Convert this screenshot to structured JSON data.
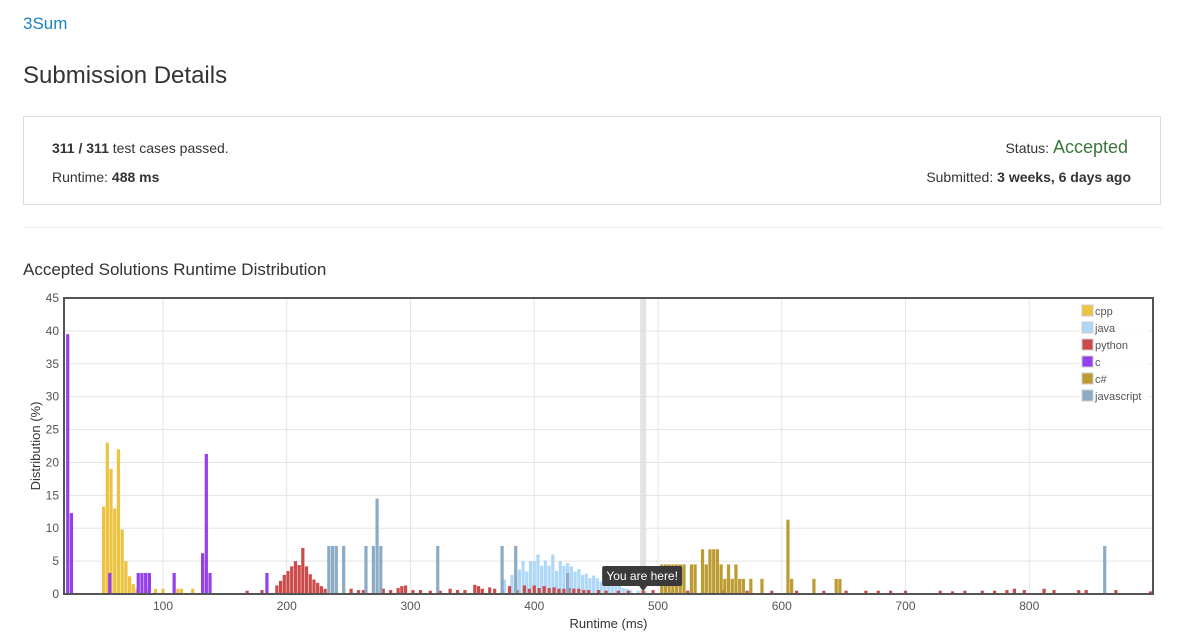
{
  "problem": {
    "title": "3Sum"
  },
  "page": {
    "title": "Submission Details"
  },
  "details": {
    "passed": "311",
    "separator": " / ",
    "total": "311",
    "passed_suffix": " test cases passed.",
    "runtime_label": "Runtime: ",
    "runtime_value": "488 ms",
    "status_label": "Status: ",
    "status_value": "Accepted",
    "submitted_label": "Submitted: ",
    "submitted_value": "3 weeks, 6 days ago"
  },
  "distribution": {
    "title": "Accepted Solutions Runtime Distribution"
  },
  "colors": {
    "accent_link": "#1a82c3",
    "status_accepted": "#3c763d",
    "cpp": "#edc240",
    "java": "#afd8f8",
    "python": "#cb4b4b",
    "c": "#9440ed",
    "csharp": "#bd9b33",
    "javascript": "#8cacc6"
  },
  "chart_data": {
    "type": "bar",
    "xlabel": "Runtime (ms)",
    "ylabel": "Distribution (%)",
    "xlim": [
      20,
      900
    ],
    "ylim": [
      0,
      45
    ],
    "x_ticks": [
      100,
      200,
      300,
      400,
      500,
      600,
      700,
      800
    ],
    "y_ticks": [
      0,
      5,
      10,
      15,
      20,
      25,
      30,
      35,
      40,
      45
    ],
    "grid": true,
    "legend_position": "top-right",
    "bar_width": 2.6,
    "highlight": {
      "x": 488,
      "label": "You are here!"
    },
    "series": [
      {
        "name": "cpp",
        "color": "#edc240",
        "points": [
          [
            52,
            13.3
          ],
          [
            55,
            23
          ],
          [
            58,
            19
          ],
          [
            61,
            13
          ],
          [
            64,
            22
          ],
          [
            67,
            9.8
          ],
          [
            70,
            5
          ],
          [
            73,
            2.7
          ],
          [
            76,
            1.5
          ],
          [
            79,
            0.8
          ],
          [
            88,
            0.8
          ],
          [
            94,
            0.8
          ],
          [
            100,
            0.8
          ],
          [
            112,
            0.8
          ],
          [
            115,
            0.8
          ],
          [
            124,
            0.8
          ]
        ]
      },
      {
        "name": "java",
        "color": "#afd8f8",
        "points": [
          [
            376,
            2.2
          ],
          [
            382,
            2.9
          ],
          [
            385,
            2.4
          ],
          [
            388,
            3.7
          ],
          [
            391,
            5
          ],
          [
            394,
            3.4
          ],
          [
            397,
            5
          ],
          [
            400,
            5
          ],
          [
            403,
            6
          ],
          [
            406,
            4.3
          ],
          [
            409,
            5.1
          ],
          [
            412,
            4.3
          ],
          [
            415,
            6
          ],
          [
            418,
            3.5
          ],
          [
            421,
            5
          ],
          [
            424,
            4.3
          ],
          [
            427,
            4.7
          ],
          [
            430,
            4.2
          ],
          [
            433,
            3.4
          ],
          [
            436,
            3.8
          ],
          [
            439,
            2.9
          ],
          [
            442,
            3.1
          ],
          [
            445,
            2.4
          ],
          [
            448,
            2.8
          ],
          [
            451,
            2.4
          ],
          [
            454,
            1.9
          ],
          [
            457,
            2.2
          ],
          [
            460,
            1.9
          ],
          [
            463,
            1.5
          ],
          [
            466,
            1.2
          ],
          [
            469,
            1.4
          ],
          [
            472,
            0.9
          ],
          [
            475,
            0.8
          ],
          [
            478,
            0.6
          ],
          [
            484,
            0.5
          ],
          [
            490,
            0.4
          ]
        ]
      },
      {
        "name": "python",
        "color": "#cb4b4b",
        "points": [
          [
            168,
            0.5
          ],
          [
            180,
            0.6
          ],
          [
            192,
            1.3
          ],
          [
            195,
            2
          ],
          [
            198,
            2.9
          ],
          [
            201,
            3.5
          ],
          [
            204,
            4.2
          ],
          [
            207,
            5
          ],
          [
            210,
            4.4
          ],
          [
            213,
            7
          ],
          [
            216,
            4.2
          ],
          [
            219,
            3
          ],
          [
            222,
            2.2
          ],
          [
            225,
            1.7
          ],
          [
            228,
            1.2
          ],
          [
            231,
            0.8
          ],
          [
            246,
            0.8
          ],
          [
            252,
            0.8
          ],
          [
            258,
            0.6
          ],
          [
            262,
            0.6
          ],
          [
            278,
            0.8
          ],
          [
            284,
            0.6
          ],
          [
            290,
            0.9
          ],
          [
            293,
            1.2
          ],
          [
            296,
            1.3
          ],
          [
            302,
            0.6
          ],
          [
            308,
            0.6
          ],
          [
            316,
            0.5
          ],
          [
            324,
            0.5
          ],
          [
            332,
            0.8
          ],
          [
            338,
            0.6
          ],
          [
            344,
            0.6
          ],
          [
            352,
            1.4
          ],
          [
            355,
            1.2
          ],
          [
            358,
            0.8
          ],
          [
            364,
            1
          ],
          [
            368,
            0.8
          ],
          [
            374,
            0.8
          ],
          [
            380,
            1.2
          ],
          [
            386,
            0.6
          ],
          [
            392,
            1.3
          ],
          [
            396,
            0.8
          ],
          [
            400,
            1.3
          ],
          [
            404,
            0.9
          ],
          [
            408,
            1.2
          ],
          [
            412,
            0.9
          ],
          [
            416,
            1
          ],
          [
            420,
            0.8
          ],
          [
            424,
            0.8
          ],
          [
            428,
            0.9
          ],
          [
            432,
            0.8
          ],
          [
            436,
            0.8
          ],
          [
            440,
            0.6
          ],
          [
            444,
            0.6
          ],
          [
            452,
            0.6
          ],
          [
            458,
            0.5
          ],
          [
            468,
            0.5
          ],
          [
            476,
            0.5
          ],
          [
            488,
            0.5
          ],
          [
            496,
            0.6
          ],
          [
            512,
            0.5
          ],
          [
            524,
            0.5
          ],
          [
            536,
            0.4
          ],
          [
            552,
            0.6
          ],
          [
            572,
            0.5
          ],
          [
            592,
            0.5
          ],
          [
            612,
            0.5
          ],
          [
            634,
            0.5
          ],
          [
            652,
            0.5
          ],
          [
            668,
            0.5
          ],
          [
            678,
            0.5
          ],
          [
            688,
            0.5
          ],
          [
            700,
            0.5
          ],
          [
            728,
            0.5
          ],
          [
            738,
            0.4
          ],
          [
            748,
            0.5
          ],
          [
            762,
            0.5
          ],
          [
            772,
            0.5
          ],
          [
            782,
            0.6
          ],
          [
            788,
            0.8
          ],
          [
            796,
            0.6
          ],
          [
            812,
            0.8
          ],
          [
            820,
            0.6
          ],
          [
            840,
            0.6
          ],
          [
            846,
            0.6
          ],
          [
            870,
            0.6
          ],
          [
            898,
            0.4
          ]
        ]
      },
      {
        "name": "c",
        "color": "#9440ed",
        "points": [
          [
            23,
            39.5
          ],
          [
            26,
            12.3
          ],
          [
            57,
            3.2
          ],
          [
            80,
            3.2
          ],
          [
            83,
            3.2
          ],
          [
            86,
            3.2
          ],
          [
            89,
            3.2
          ],
          [
            109,
            3.2
          ],
          [
            132,
            6.2
          ],
          [
            135,
            21.3
          ],
          [
            138,
            3.2
          ],
          [
            184,
            3.2
          ]
        ]
      },
      {
        "name": "c#",
        "color": "#bd9b33",
        "points": [
          [
            503,
            4.5
          ],
          [
            506,
            4.5
          ],
          [
            509,
            4.5
          ],
          [
            512,
            4.5
          ],
          [
            515,
            4.5
          ],
          [
            518,
            4.5
          ],
          [
            521,
            4.5
          ],
          [
            527,
            4.5
          ],
          [
            530,
            4.5
          ],
          [
            536,
            6.8
          ],
          [
            539,
            4.5
          ],
          [
            542,
            6.8
          ],
          [
            545,
            6.8
          ],
          [
            548,
            6.8
          ],
          [
            551,
            4.5
          ],
          [
            554,
            2.3
          ],
          [
            557,
            4.5
          ],
          [
            560,
            2.3
          ],
          [
            563,
            4.5
          ],
          [
            566,
            2.3
          ],
          [
            569,
            2.3
          ],
          [
            575,
            2.3
          ],
          [
            584,
            2.3
          ],
          [
            605,
            11.3
          ],
          [
            608,
            2.3
          ],
          [
            626,
            2.3
          ],
          [
            644,
            2.3
          ],
          [
            647,
            2.3
          ]
        ]
      },
      {
        "name": "javascript",
        "color": "#8cacc6",
        "points": [
          [
            234,
            7.3
          ],
          [
            237,
            7.3
          ],
          [
            240,
            7.3
          ],
          [
            246,
            7.3
          ],
          [
            264,
            7.3
          ],
          [
            270,
            7.3
          ],
          [
            273,
            14.5
          ],
          [
            276,
            7.3
          ],
          [
            322,
            7.3
          ],
          [
            374,
            7.3
          ],
          [
            385,
            7.3
          ],
          [
            427,
            3.2
          ],
          [
            861,
            7.3
          ]
        ]
      }
    ]
  }
}
